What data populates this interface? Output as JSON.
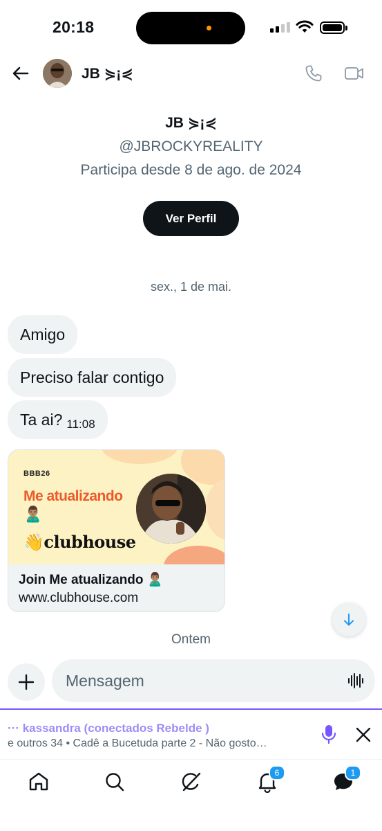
{
  "status_bar": {
    "time": "20:18"
  },
  "header": {
    "name": "JB ⋟¡⋞"
  },
  "profile": {
    "name": "JB ⋟¡⋞",
    "handle": "@JBROCKYREALITY",
    "joined": "Participa desde 8 de ago. de 2024",
    "view_profile_label": "Ver Perfil"
  },
  "conversation": {
    "date_separator": "sex., 1 de mai.",
    "messages": [
      {
        "text": "Amigo"
      },
      {
        "text": "Preciso falar contigo"
      },
      {
        "text": "Ta ai?",
        "time": "11:08"
      }
    ],
    "link_card": {
      "tag": "BBB26",
      "art_title": "Me atualizando",
      "art_emoji": "🙎🏽‍♂️",
      "logo_text": "👋clubhouse",
      "title": "Join Me atualizando 🙎🏽‍♂️",
      "url": "www.clubhouse.com"
    },
    "date_separator_2": "Ontem"
  },
  "composer": {
    "placeholder": "Mensagem"
  },
  "space": {
    "line1": "··· kassandra (conectados Rebelde )",
    "line2": "e outros 34 • Cadê a Bucetuda parte 2 - Não gosto…"
  },
  "bottom_nav": {
    "notifications_badge": "6",
    "messages_badge": "1"
  },
  "colors": {
    "accent": "#1d9bf0",
    "space_purple": "#7856ff",
    "bubble_bg": "#eff3f4",
    "muted_text": "#536471"
  }
}
